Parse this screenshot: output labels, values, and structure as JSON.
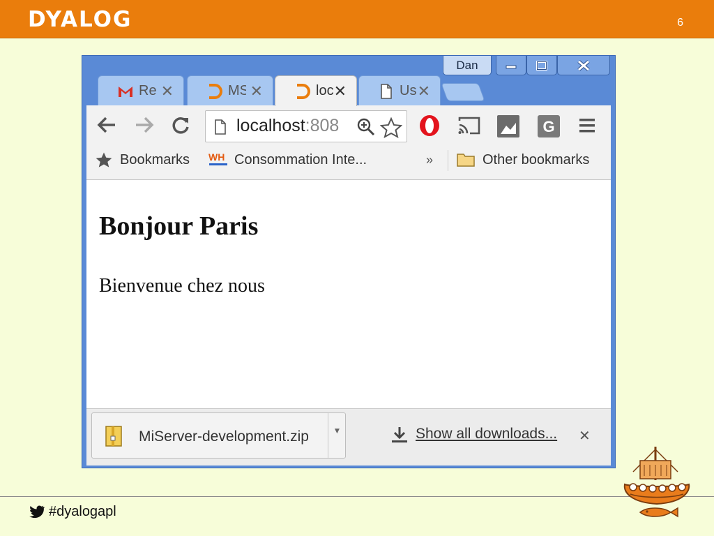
{
  "slide": {
    "brand": "DYALOG",
    "page_number": "6",
    "hashtag": "#dyalogapl",
    "accent_color": "#ea7d0c",
    "background_color": "#f7fdd9"
  },
  "browser": {
    "user_badge": "Dan",
    "tabs": [
      {
        "title": "Re",
        "icon": "gmail-icon",
        "active": false
      },
      {
        "title": "MS",
        "icon": "dyalog-icon",
        "active": false
      },
      {
        "title": "loc",
        "icon": "dyalog-icon",
        "active": true
      },
      {
        "title": "Us",
        "icon": "page-icon",
        "active": false
      }
    ],
    "address": {
      "host": "localhost",
      "port_partial": ":808"
    },
    "bookmarks": {
      "bookmarks_label": "Bookmarks",
      "items": [
        "Consommation Inte..."
      ],
      "overflow": "»",
      "other_label": "Other bookmarks"
    },
    "page": {
      "heading": "Bonjour Paris",
      "paragraph": "Bienvenue chez nous"
    },
    "downloads": {
      "file_name": "MiServer-development.zip",
      "show_all": "Show all downloads..."
    }
  }
}
